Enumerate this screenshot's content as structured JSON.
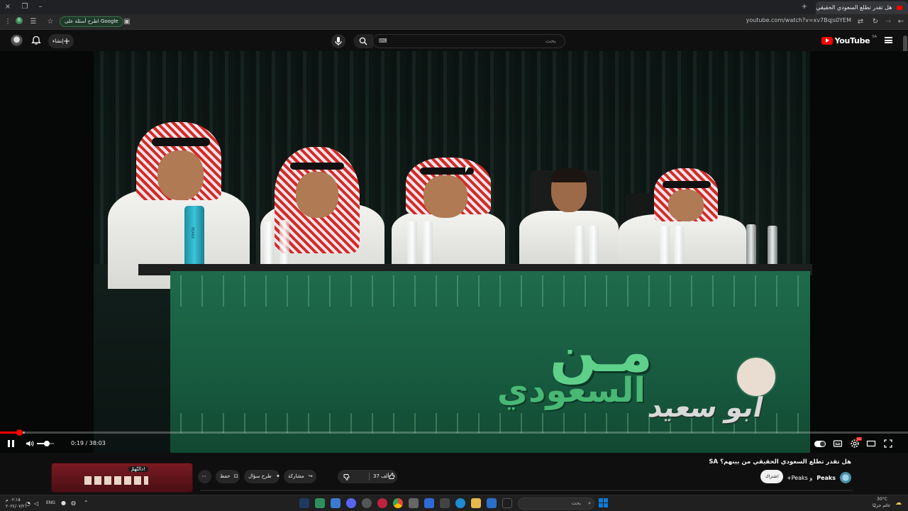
{
  "browser": {
    "tab_title": "هل تقدر تطلع السعودي الحقيقي من بينهم؟ SA",
    "url": "youtube.com/watch?v=xv7Bqjs0YEM",
    "google_chip_label": "اطرح أسئلة على Google",
    "new_tab_symbol": "+",
    "close_symbol": "×"
  },
  "youtube": {
    "logo_word": "YouTube",
    "country_code": "SA",
    "search_placeholder": "بحث",
    "create_label": "إنشاء"
  },
  "video": {
    "show_title_big": "مـن",
    "show_title_small": "السعودي",
    "host_name": "ابو سعيد",
    "bottle_brand": "PEAKS",
    "current_time": "0:19",
    "duration": "38:03",
    "time_display": "0:19 / 38:03",
    "progress_fraction": 0.0083,
    "buffered_fraction": 0.027,
    "volume_fraction": 0.6,
    "autoplay_on": true,
    "hd_badge": "HD"
  },
  "details": {
    "title": "هل تقدر تطلع السعودي الحقيقي من بينهم؟ SA",
    "channel_name": "Peaks",
    "channel_suffix": "و Peaks+",
    "subscribe_label": "اشتراك",
    "likes": "37 ألف",
    "share_label": "مشاركة",
    "ask_label": "طرح سؤال",
    "save_label": "حفظ",
    "more_symbol": "⋯",
    "playlist_card_label": "دالنّهمّ!"
  },
  "taskbar": {
    "search_placeholder": "بحث",
    "language": "ENG",
    "weather_temp": "30°C",
    "weather_text": "غائم جزئيًا",
    "clock_time": "٠٢:١٥ م",
    "clock_date": "٢٠٢٤/٠٧/٢١"
  },
  "colors": {
    "youtube_red": "#ff0000",
    "background": "#0f0f0f",
    "table_green": "#1f6b4c",
    "logo_green": "#5fd08a"
  },
  "icons": [
    "search-icon",
    "mic-icon",
    "bell-icon",
    "menu-icon",
    "pause-icon",
    "volume-icon",
    "settings-icon",
    "captions-icon",
    "fullscreen-icon",
    "theater-icon",
    "like-icon",
    "dislike-icon",
    "share-icon",
    "save-icon",
    "windows-icon"
  ]
}
